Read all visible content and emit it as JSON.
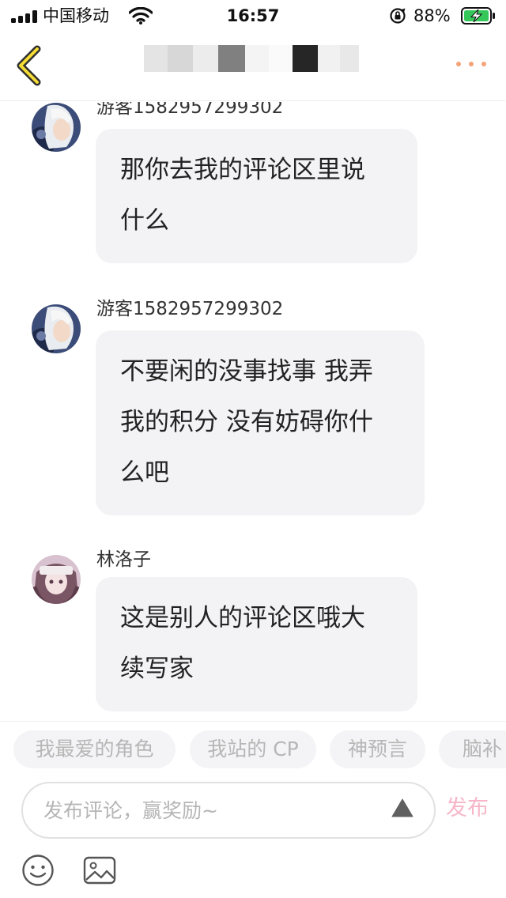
{
  "status_bar": {
    "carrier": "中国移动",
    "time": "16:57",
    "battery": "88%"
  },
  "nav": {
    "title_redacted": true
  },
  "messages": [
    {
      "user": "游客15829572993​02",
      "text_lines": [
        "那你去我的评论区里说",
        "什么"
      ]
    },
    {
      "user": "游客15829572993​02",
      "text_lines": [
        "不要闲的没事找事 我弄",
        "我的积分 没有妨碍你什",
        "么吧"
      ]
    },
    {
      "user": "林洛子",
      "text_lines": [
        "这是别人的评论区哦大",
        "续写家"
      ]
    }
  ],
  "topics": [
    "我最爱的角色",
    "我站的 CP",
    "神预言",
    "脑补"
  ],
  "composer": {
    "placeholder": "发布评论，赢奖励~",
    "publish_label": "发布"
  },
  "colors": {
    "accent_orange": "#f3a37a",
    "publish_pink": "#f7b6c8",
    "bubble_bg": "#f3f3f5",
    "chip_bg": "#f4f4f6"
  },
  "icons": {
    "back": "chevron-left-icon",
    "more": "more-dots-icon",
    "expand": "triangle-up-icon",
    "emoji": "emoji-icon",
    "image": "image-icon"
  }
}
